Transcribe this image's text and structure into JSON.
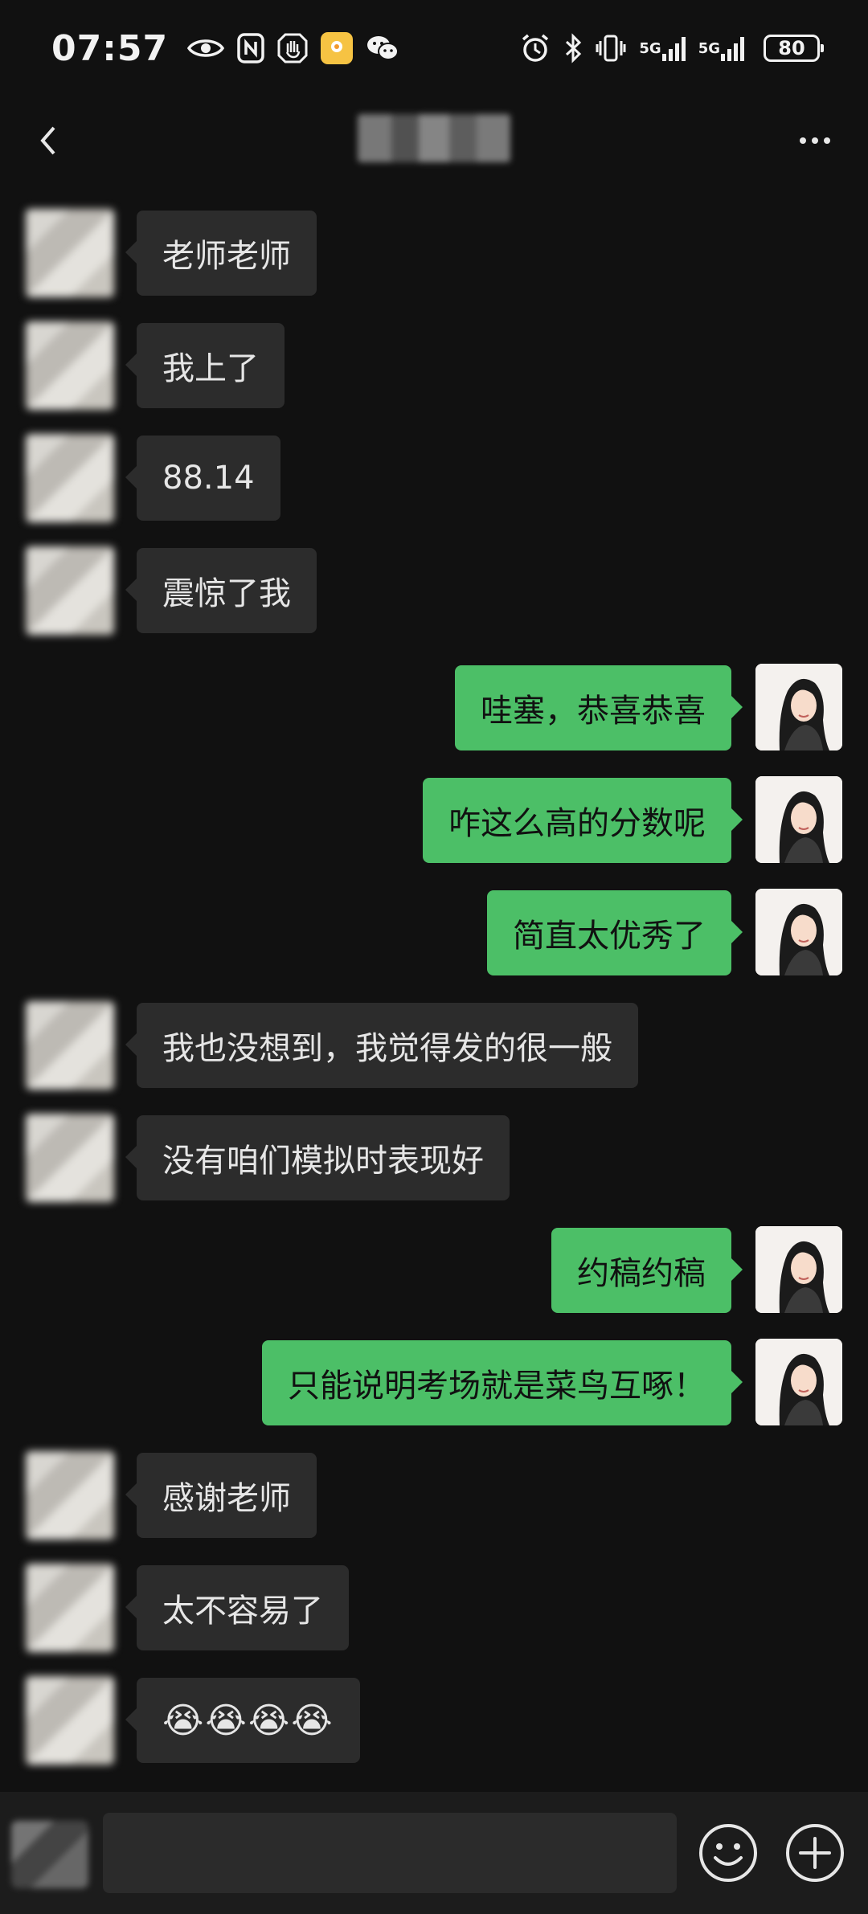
{
  "status_bar": {
    "time": "07:57",
    "network_1": "5G",
    "network_2": "5G",
    "battery": "80"
  },
  "nav": {
    "title": "",
    "back_icon": "chevron-left-icon",
    "more_icon": "more-dots-icon"
  },
  "colors": {
    "background": "#111111",
    "incoming_bubble": "#2c2c2c",
    "outgoing_bubble": "#4cbf67",
    "input_bar": "#1c1c1c"
  },
  "messages": [
    {
      "side": "in",
      "text": "老师老师"
    },
    {
      "side": "in",
      "text": "我上了"
    },
    {
      "side": "in",
      "text": "88.14"
    },
    {
      "side": "in",
      "text": "震惊了我"
    },
    {
      "side": "out",
      "text": "哇塞，恭喜恭喜"
    },
    {
      "side": "out",
      "text": "咋这么高的分数呢"
    },
    {
      "side": "out",
      "text": "简直太优秀了"
    },
    {
      "side": "in",
      "text": "我也没想到，我觉得发的很一般"
    },
    {
      "side": "in",
      "text": "没有咱们模拟时表现好"
    },
    {
      "side": "out",
      "text": "约稿约稿"
    },
    {
      "side": "out",
      "text": "只能说明考场就是菜鸟互啄！"
    },
    {
      "side": "in",
      "text": "感谢老师"
    },
    {
      "side": "in",
      "text": "太不容易了"
    },
    {
      "side": "in",
      "text": "😭😭😭😭"
    }
  ],
  "input_bar": {
    "value": "",
    "voice_icon": "voice-icon",
    "emoji_icon": "emoji-icon",
    "add_icon": "plus-circle-icon"
  }
}
